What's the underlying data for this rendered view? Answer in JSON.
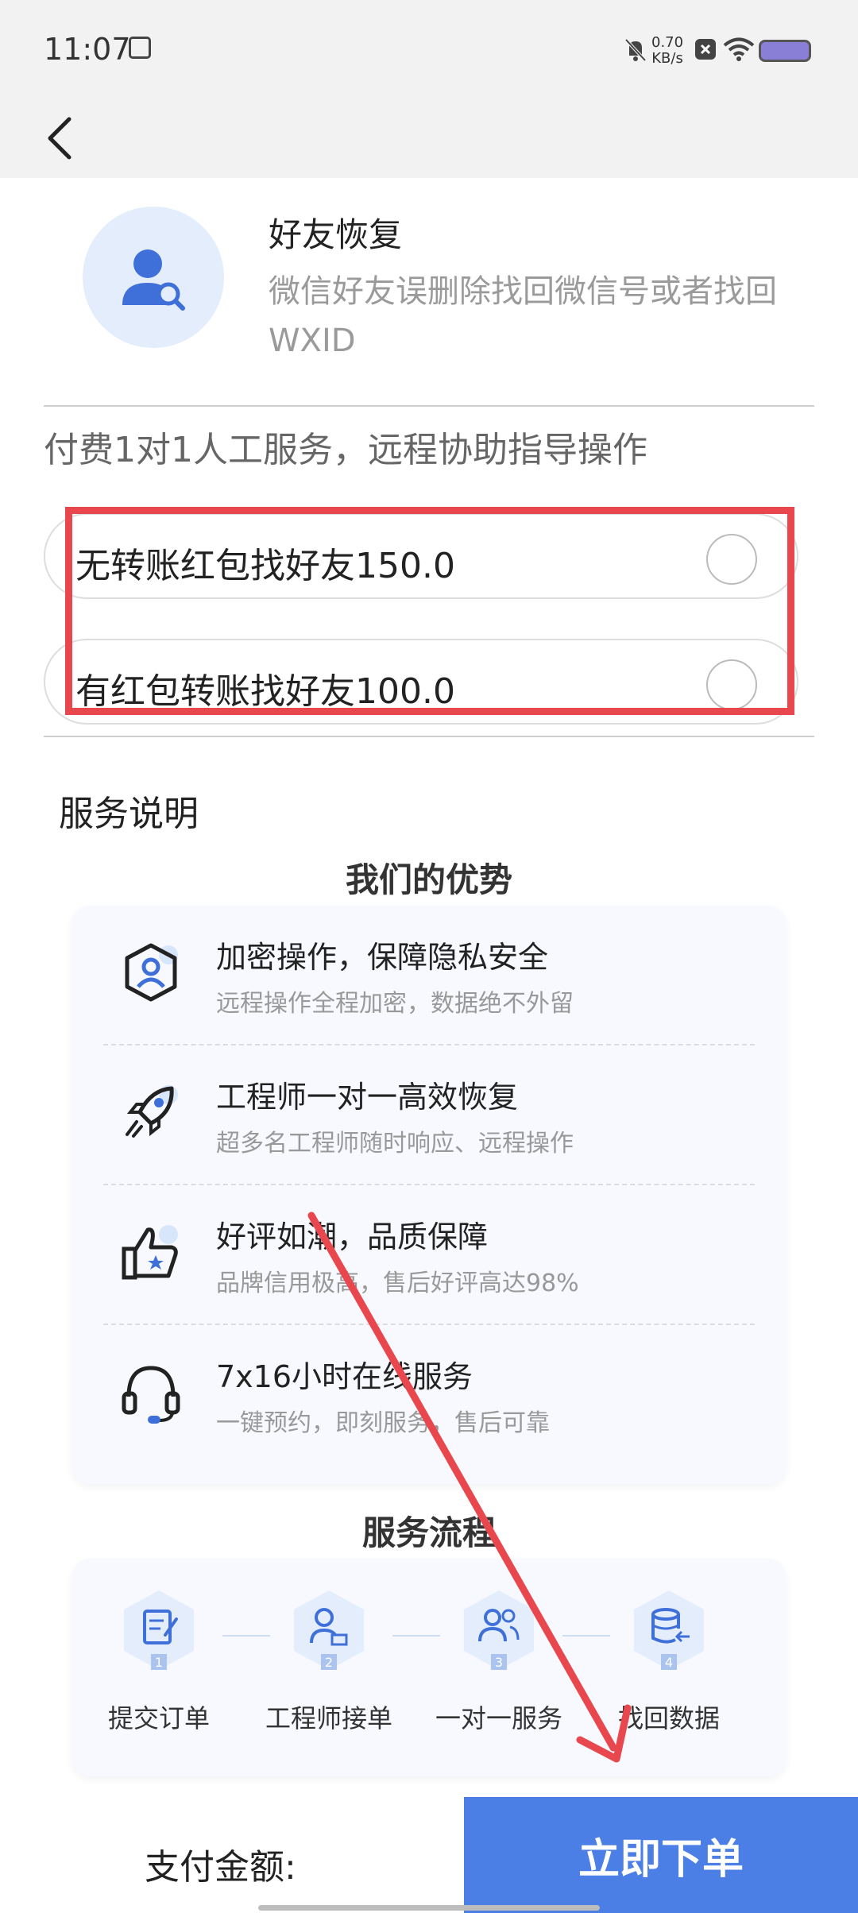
{
  "status_bar": {
    "time": "11:07",
    "net_speed_value": "0.70",
    "net_speed_unit": "KB/s"
  },
  "service": {
    "title": "好友恢复",
    "description": "微信好友误删除找回微信号或者找回WXID",
    "paid_note": "付费1对1人工服务，远程协助指导操作",
    "options": [
      {
        "label": "无转账红包找好友150.0",
        "selected": false
      },
      {
        "label": "有红包转账找好友100.0",
        "selected": false
      }
    ]
  },
  "service_section": {
    "label": "服务说明",
    "advantages_heading": "我们的优势",
    "advantages": [
      {
        "icon": "user-shield-icon",
        "title": "加密操作，保障隐私安全",
        "desc": "远程操作全程加密，数据绝不外留"
      },
      {
        "icon": "rocket-icon",
        "title": "工程师一对一高效恢复",
        "desc": "超多名工程师随时响应、远程操作"
      },
      {
        "icon": "thumbs-up-icon",
        "title": "好评如潮，品质保障",
        "desc": "品牌信用极高，售后好评高达98%"
      },
      {
        "icon": "headset-icon",
        "title": "7x16小时在线服务",
        "desc": "一键预约，即刻服务，售后可靠"
      }
    ],
    "process_heading": "服务流程",
    "steps": [
      {
        "icon": "edit-document-icon",
        "number": "1",
        "label": "提交订单"
      },
      {
        "icon": "engineer-icon",
        "number": "2",
        "label": "工程师接单"
      },
      {
        "icon": "users-icon",
        "number": "3",
        "label": "一对一服务"
      },
      {
        "icon": "database-icon",
        "number": "4",
        "label": "找回数据"
      }
    ]
  },
  "footer": {
    "pay_label": "支付金额:",
    "order_button": "立即下单"
  },
  "colors": {
    "accent": "#4b7fe5",
    "highlight": "#e8484d",
    "icon_blue": "#3f6fd8"
  }
}
